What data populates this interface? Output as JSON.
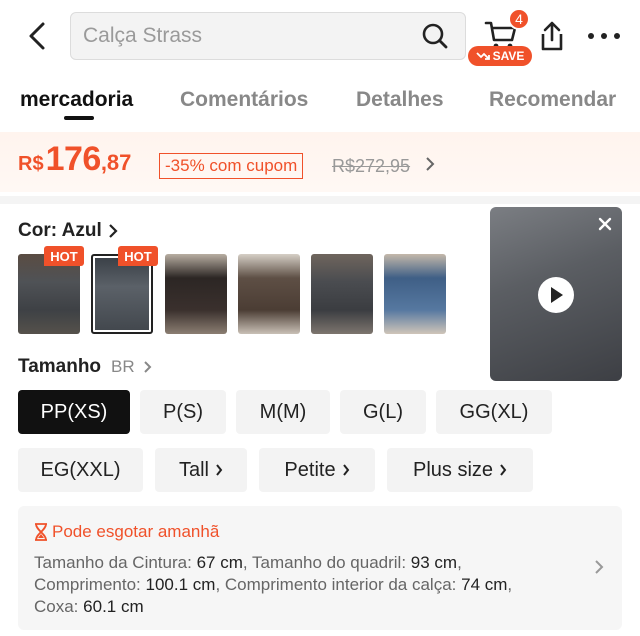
{
  "header": {
    "search_placeholder": "Calça Strass",
    "cart_count": "4",
    "save_label": "SAVE"
  },
  "tabs": [
    {
      "label": "mercadoria",
      "active": true
    },
    {
      "label": "Comentários",
      "active": false
    },
    {
      "label": "Detalhes",
      "active": false
    },
    {
      "label": "Recomendar",
      "active": false
    }
  ],
  "price": {
    "currency": "R$",
    "integer": "176",
    "decimal": ",87",
    "coupon": "-35% com cupom",
    "original": "R$272,95"
  },
  "color": {
    "label": "Cor: Azul",
    "hot_label": "HOT",
    "selected_index": 1
  },
  "size": {
    "label": "Tamanho",
    "region": "BR",
    "options": [
      "PP(XS)",
      "P(S)",
      "M(M)",
      "G(L)",
      "GG(XL)",
      "EG(XXL)",
      "Tall",
      "Petite",
      "Plus size"
    ],
    "selected": "PP(XS)"
  },
  "stock": {
    "warning": "Pode esgotar amanhã",
    "waist_label": "Tamanho da Cintura:",
    "waist_value": "67 cm",
    "hip_label": "Tamanho do quadril:",
    "hip_value": "93 cm",
    "length_label": "Comprimento:",
    "length_value": "100.1 cm",
    "inseam_label": "Comprimento interior da calça:",
    "inseam_value": "74 cm",
    "thigh_label": "Coxa:",
    "thigh_value": "60.1 cm"
  },
  "colors": {
    "accent": "#f0512a",
    "selected_bg": "#111111"
  }
}
